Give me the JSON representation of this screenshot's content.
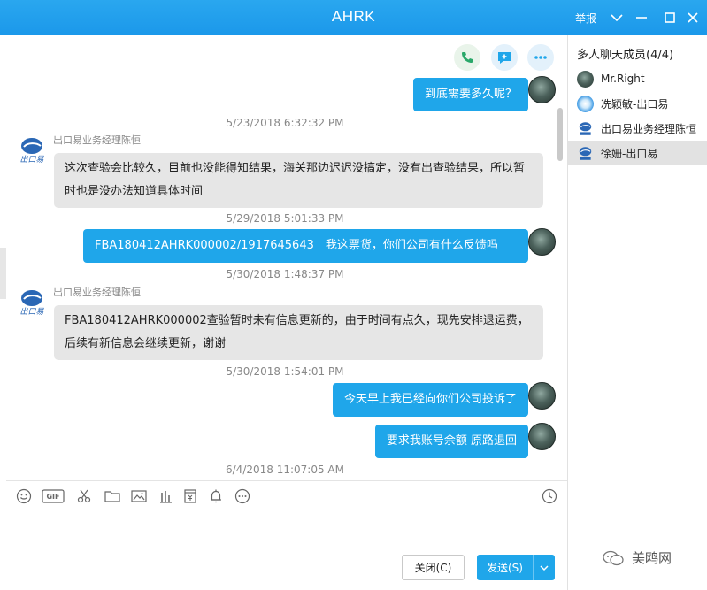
{
  "window": {
    "title": "AHRK",
    "report_label": "举报"
  },
  "chat": {
    "messages": [
      {
        "side": "right",
        "text": "到底需要多久呢？"
      },
      {
        "timestamp": "5/23/2018 6:32:32 PM"
      },
      {
        "side": "left",
        "sender": "出口易业务经理陈恒",
        "lines": [
          "这次查验会比较久，目前也没能得知结果，海关那边迟迟没搞定，没有出查验结果，所以暂",
          "时也是没办法知道具体时间"
        ]
      },
      {
        "timestamp": "5/29/2018 5:01:33 PM"
      },
      {
        "side": "right",
        "text": "FBA180412AHRK000002/1917645643　我这票货，你们公司有什么反馈吗"
      },
      {
        "timestamp": "5/30/2018 1:48:37 PM"
      },
      {
        "side": "left",
        "sender": "出口易业务经理陈恒",
        "lines": [
          "FBA180412AHRK000002查验暂时未有信息更新的，由于时间有点久，现先安排退运费，",
          "后续有新信息会继续更新，谢谢"
        ]
      },
      {
        "timestamp": "5/30/2018 1:54:01 PM"
      },
      {
        "side": "right",
        "text": "今天早上我已经向你们公司投诉了"
      },
      {
        "side": "right",
        "text": "要求我账号余额 原路退回"
      },
      {
        "timestamp": "6/4/2018 11:07:05 AM"
      }
    ]
  },
  "toolbar": {
    "icons": [
      "smile-icon",
      "gif-icon",
      "scissors-icon",
      "folder-icon",
      "image-icon",
      "chart-icon",
      "red-packet-icon",
      "bell-icon",
      "more-icon",
      "history-clock-icon"
    ],
    "gif_label": "GIF"
  },
  "buttons": {
    "close_label": "关闭(C)",
    "send_label": "发送(S)"
  },
  "members": {
    "header": "多人聊天成员(4/4)",
    "list": [
      {
        "name": "Mr.Right",
        "avatar": "photo"
      },
      {
        "name": "冼颖敏-出口易",
        "avatar": "blue-ring"
      },
      {
        "name": "出口易业务经理陈恒",
        "avatar": "company-logo"
      },
      {
        "name": "徐姗-出口易",
        "avatar": "company-logo",
        "selected": true
      }
    ]
  },
  "watermark": "美鸥网",
  "colors": {
    "title_bar": "#1b98ea",
    "bubble_right": "#1fa6ea",
    "bubble_left": "#e6e6e6",
    "selected_member": "#e2e2e2"
  }
}
